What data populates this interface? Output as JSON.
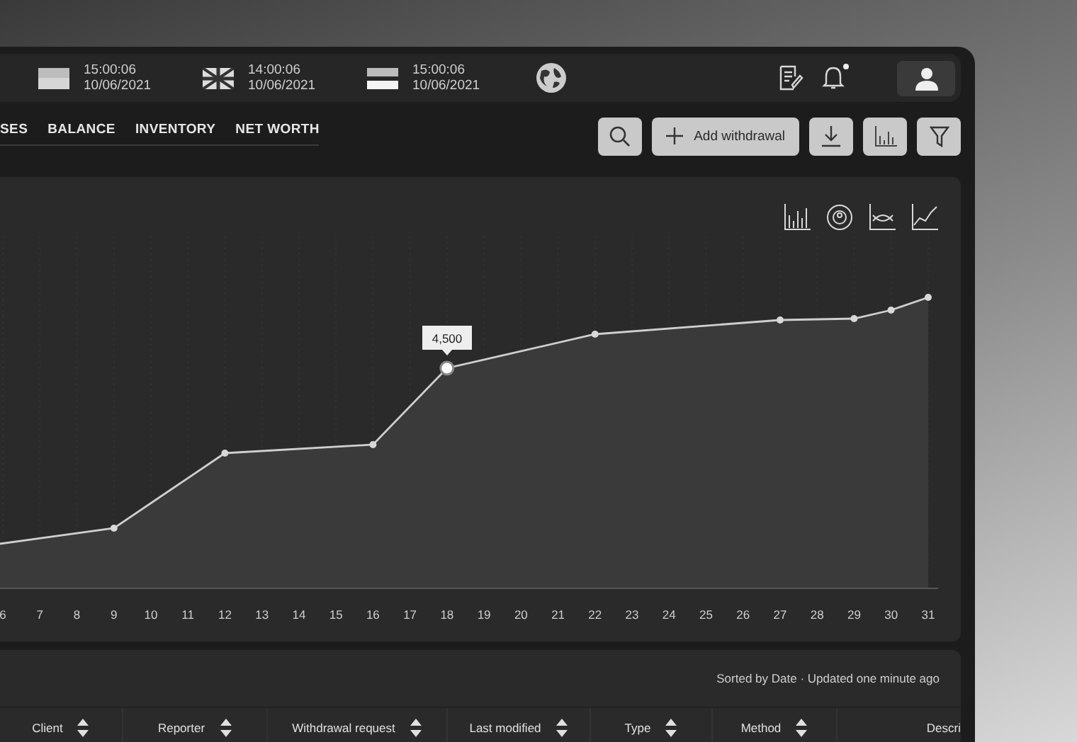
{
  "top_bar": {
    "clocks": [
      {
        "kind": "plain",
        "time": "15:00:06",
        "date": "10/06/2021"
      },
      {
        "kind": "cross",
        "time": "14:00:06",
        "date": "10/06/2021"
      },
      {
        "kind": "striped",
        "time": "15:00:06",
        "date": "10/06/2021"
      }
    ],
    "bell": {
      "has_unread": true
    }
  },
  "tabs": [
    "SES",
    "BALANCE",
    "INVENTORY",
    "NET WORTH"
  ],
  "toolbar": {
    "add_button": "Add withdrawal"
  },
  "chart": {
    "chart_types": [
      {
        "kind": "bar"
      },
      {
        "kind": "donut"
      },
      {
        "kind": "curve"
      },
      {
        "kind": "area"
      }
    ],
    "x_labels": [
      "6",
      "7",
      "8",
      "9",
      "10",
      "11",
      "12",
      "13",
      "14",
      "15",
      "16",
      "17",
      "18",
      "19",
      "20",
      "21",
      "22",
      "23",
      "24",
      "25",
      "26",
      "27",
      "28",
      "29",
      "30",
      "31"
    ],
    "tooltip": "4,500"
  },
  "table": {
    "status": "Sorted by Date · Updated one minute ago",
    "columns": [
      "Client",
      "Reporter",
      "Withdrawal request",
      "Last modified",
      "Type",
      "Method",
      "Descri"
    ]
  }
}
